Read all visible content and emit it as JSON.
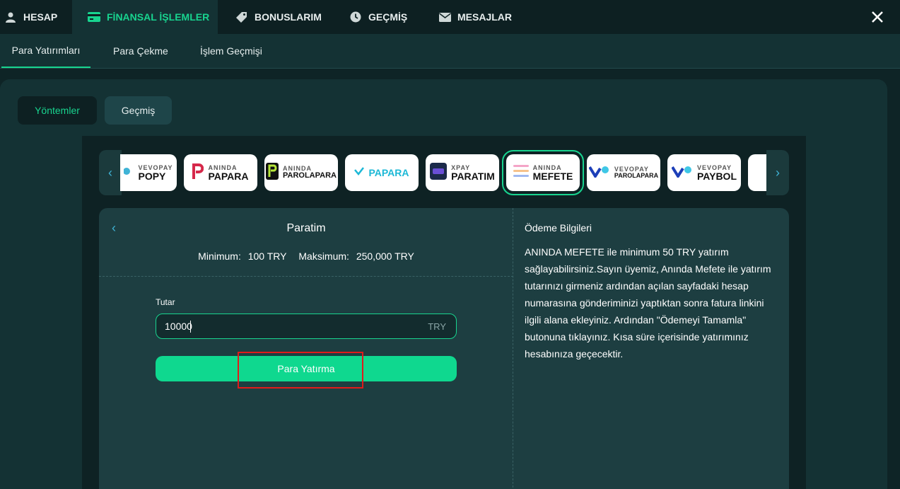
{
  "topnav": {
    "tabs": [
      {
        "label": "HESAP",
        "icon": "user-icon"
      },
      {
        "label": "FİNANSAL İŞLEMLER",
        "icon": "card-icon",
        "active": true
      },
      {
        "label": "BONUSLARIM",
        "icon": "tag-icon"
      },
      {
        "label": "GEÇMİŞ",
        "icon": "clock-icon"
      },
      {
        "label": "MESAJLAR",
        "icon": "mail-icon"
      }
    ],
    "close_icon": "close-icon"
  },
  "subnav": {
    "tabs": [
      {
        "label": "Para Yatırımları",
        "active": true
      },
      {
        "label": "Para Çekme"
      },
      {
        "label": "İşlem Geçmişi"
      }
    ]
  },
  "segment": {
    "methods_label": "Yöntemler",
    "history_label": "Geçmiş"
  },
  "carousel": {
    "items": [
      {
        "small": "VEVOPAY",
        "big": "POPY"
      },
      {
        "small": "ANINDA",
        "big": "PAPARA"
      },
      {
        "small": "ANINDA",
        "big": "PAROLAPARA"
      },
      {
        "small": "",
        "big": "PAPARA"
      },
      {
        "small": "XPAY",
        "big": "PARATIM"
      },
      {
        "small": "ANINDA",
        "big": "MEFETE",
        "selected": true
      },
      {
        "small": "VEVOPAY",
        "big": "PAROLAPARA"
      },
      {
        "small": "VEVOPAY",
        "big": "PAYBOL"
      }
    ]
  },
  "form": {
    "title": "Paratim",
    "min_label": "Minimum:",
    "min_value": "100 TRY",
    "max_label": "Maksimum:",
    "max_value": "250,000 TRY",
    "amount_label": "Tutar",
    "amount_value": "10000",
    "amount_unit": "TRY",
    "submit_label": "Para Yatırma"
  },
  "info": {
    "title": "Ödeme Bilgileri",
    "text": "ANINDA MEFETE ile minimum 50 TRY yatırım sağlayabilirsiniz.Sayın üyemiz, Anında Mefete ile yatırım tutarınızı girmeniz ardından açılan sayfadaki hesap numarasına gönderiminizi yaptıktan sonra fatura linkini ilgili alana ekleyiniz. Ardından \"Ödemeyi Tamamla\" butonuna tıklayınız. Kısa süre içerisinde yatırımınız hesabınıza geçecektir."
  },
  "colors": {
    "accent": "#18d48f",
    "button": "#0fd88f",
    "highlight": "#e01b1b"
  }
}
